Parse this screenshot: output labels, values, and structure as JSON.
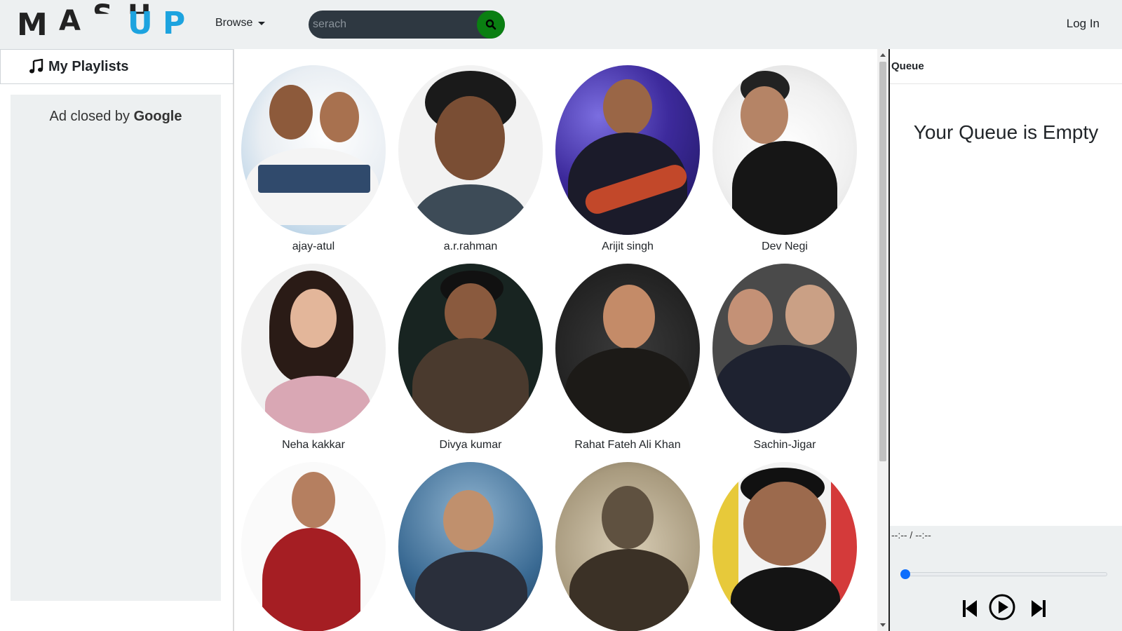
{
  "header": {
    "logo_letters": [
      "M",
      "A",
      "S",
      "H",
      "U",
      "P"
    ],
    "logo_colors": {
      "dark": "#222222",
      "blue": "#1ca3df"
    },
    "browse_label": "Browse",
    "search_placeholder": "serach",
    "search_icon": "search-icon",
    "login_label": "Log In"
  },
  "sidebar": {
    "playlists_icon": "music-note-icon",
    "playlists_label": "My Playlists",
    "ad_text": "Ad closed by",
    "ad_brand": "Google"
  },
  "artists": [
    {
      "name": "ajay-atul"
    },
    {
      "name": "a.r.rahman"
    },
    {
      "name": "Arijit singh"
    },
    {
      "name": "Dev Negi"
    },
    {
      "name": "Neha kakkar"
    },
    {
      "name": "Divya kumar"
    },
    {
      "name": "Rahat Fateh Ali Khan"
    },
    {
      "name": "Sachin-Jigar"
    },
    {
      "name": ""
    },
    {
      "name": ""
    },
    {
      "name": ""
    },
    {
      "name": ""
    }
  ],
  "queue": {
    "title": "Queue",
    "empty_message": "Your Queue is Empty",
    "time_display": "--:-- / --:--",
    "progress": 0,
    "controls": [
      "previous-icon",
      "play-icon",
      "next-icon"
    ]
  },
  "colors": {
    "navbar_bg": "#edf0f1",
    "search_bg": "#2e3841",
    "search_button": "#0a7f12",
    "accent": "#0d6efd"
  }
}
